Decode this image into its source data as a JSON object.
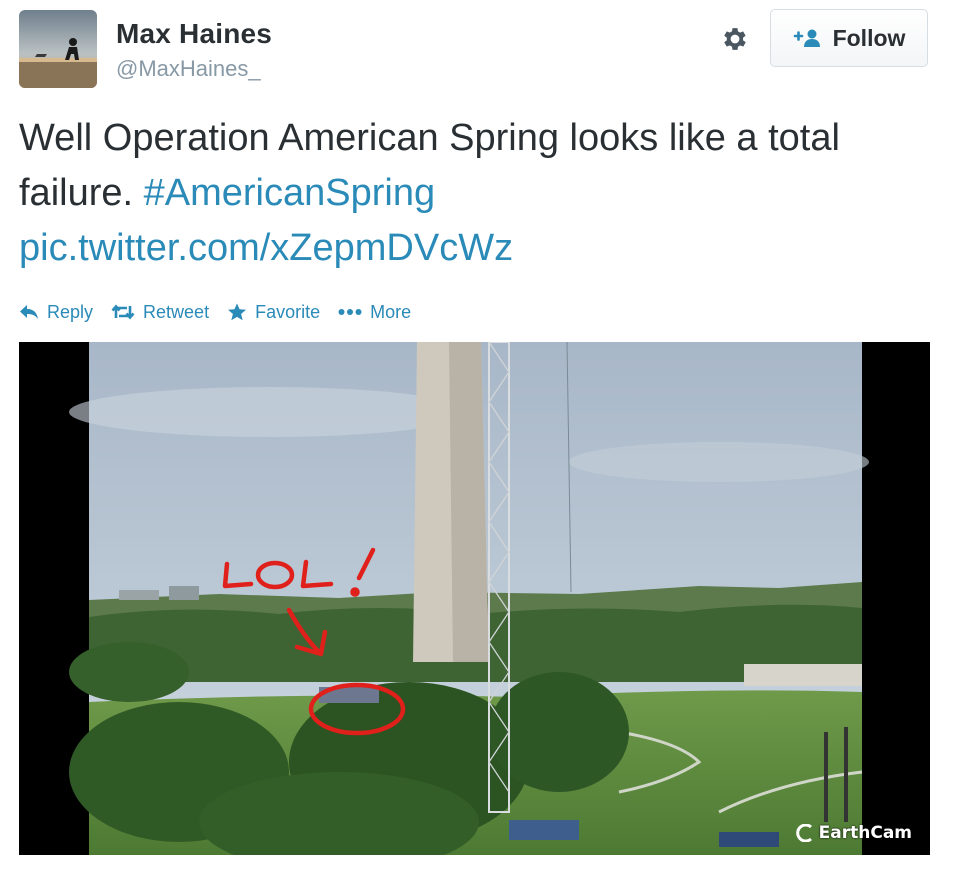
{
  "user": {
    "name": "Max Haines",
    "handle": "@MaxHaines_"
  },
  "header": {
    "gear_icon": "gear-icon",
    "follow_label": "Follow"
  },
  "tweet": {
    "text": "Well Operation American Spring looks like a total failure.",
    "hashtag": "#AmericanSpring",
    "link": "pic.twitter.com/xZepmDVcWz"
  },
  "actions": [
    {
      "label": "Reply",
      "icon": "reply-icon"
    },
    {
      "label": "Retweet",
      "icon": "retweet-icon"
    },
    {
      "label": "Favorite",
      "icon": "star-icon"
    },
    {
      "label": "More",
      "icon": "more-icon"
    }
  ],
  "media": {
    "annotation": "LOL!",
    "watermark": "EarthCam"
  },
  "colors": {
    "link": "#2a8ab8",
    "text": "#292f33",
    "muted": "#8899a6",
    "annotation": "#e0201a"
  }
}
